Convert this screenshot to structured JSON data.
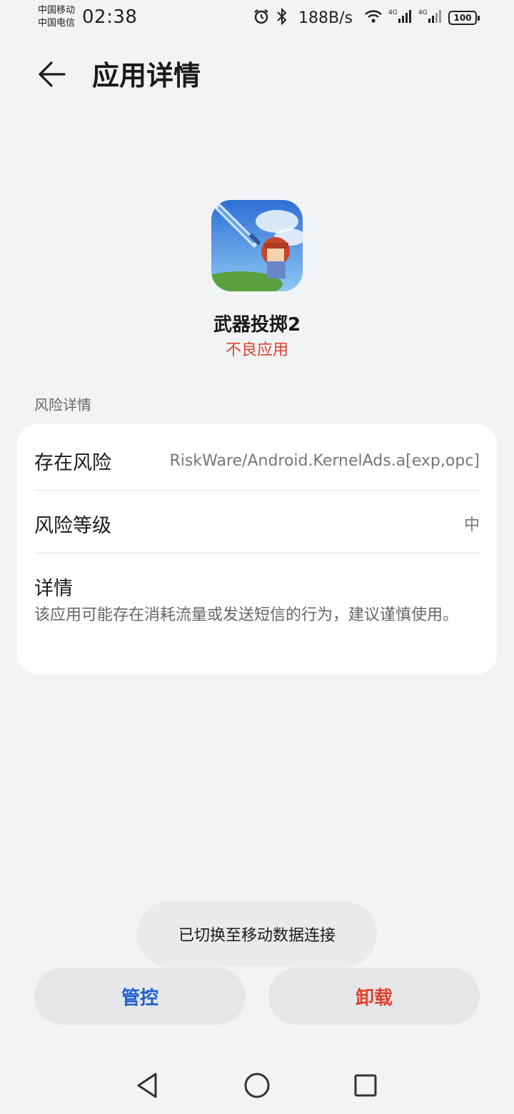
{
  "status_bar": {
    "carrier_1": "中国移动",
    "carrier_2": "中国电信",
    "time": "02:38",
    "net_speed": "188B/s",
    "battery": "100",
    "icons": [
      "alarm-icon",
      "bluetooth-icon",
      "wifi-icon",
      "signal-4g-icon",
      "signal-4g-icon",
      "battery-icon"
    ]
  },
  "header": {
    "back_icon": "arrow-left-icon",
    "title": "应用详情"
  },
  "app": {
    "name": "武器投掷2",
    "tag": "不良应用",
    "tag_color": "#e0412f"
  },
  "risk_section": {
    "label": "风险详情",
    "rows": [
      {
        "label": "存在风险",
        "value": "RiskWare/Android.KernelAds.a[exp,opc]"
      },
      {
        "label": "风险等级",
        "value": "中"
      }
    ],
    "detail_title": "详情",
    "detail_text": "该应用可能存在消耗流量或发送短信的行为，建议谨慎使用。"
  },
  "toast": {
    "text": "已切换至移动数据连接"
  },
  "actions": {
    "control_label": "管控",
    "control_color": "#1f5fd1",
    "uninstall_label": "卸载",
    "uninstall_color": "#e0412f"
  },
  "nav_bar": {
    "icons": [
      "back-triangle-icon",
      "home-circle-icon",
      "recents-square-icon"
    ]
  }
}
